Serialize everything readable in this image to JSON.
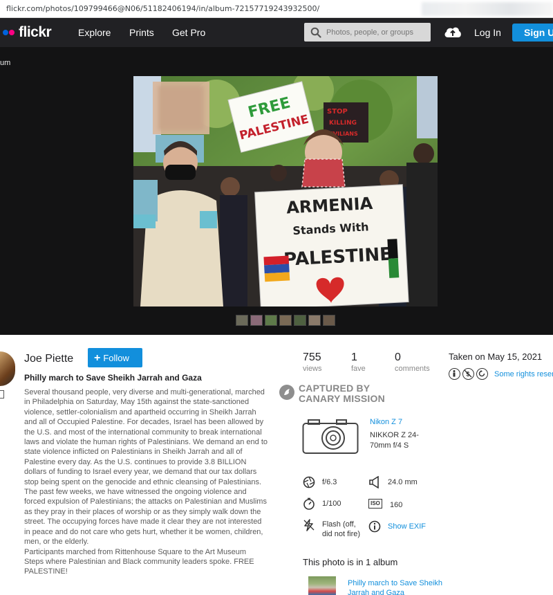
{
  "browser": {
    "url": "flickr.com/photos/109799466@N06/51182406194/in/album-72157719243932500/"
  },
  "nav": {
    "logo_text": "flickr",
    "links": [
      "Explore",
      "Prints",
      "Get Pro"
    ],
    "search_placeholder": "Photos, people, or groups",
    "login": "Log In",
    "signup": "Sign Up",
    "icons": {
      "search": "search-icon",
      "upload": "cloud-upload-icon"
    }
  },
  "stage": {
    "crumb": "um",
    "photo_signs": {
      "top_sign": [
        "FREE",
        "PALESTINE"
      ],
      "back_sign": [
        "STOP",
        "KILLING",
        "CIVILIANS"
      ],
      "main_sign": [
        "ARMENIA",
        "Stands With",
        "PALESTINE"
      ]
    },
    "filmstrip_count": 7
  },
  "author": {
    "name": "Joe Piette",
    "follow_label": "Follow"
  },
  "photo": {
    "title": "Philly march to Save Sheikh Jarrah and Gaza",
    "description": [
      "Several thousand people, very diverse and multi-generational, marched in Philadelphia on Saturday, May 15th against the state-sanctioned violence, settler-colonialism and apartheid occurring in Sheikh Jarrah and all of Occupied Palestine. For decades, Israel has been allowed by the U.S. and most of the international community to break international laws and violate the human rights of Palestinians. We demand an end to state violence inflicted on Palestinians in Sheikh Jarrah and all of Palestine every day. As the U.S. continues to provide 3.8 BILLION dollars of funding to Israel every year, we demand that our tax dollars stop being spent on the genocide and ethnic cleansing of Palestinians.",
      "The past few weeks, we have witnessed the ongoing violence and forced expulsion of Palestinians; the attacks on Palestinian and Muslims as they pray in their places of worship or as they simply walk down the street. The occupying forces have made it clear they are not interested in peace and do not care who gets hurt, whether it be women, children, men, or the elderly.",
      "Participants marched from Rittenhouse Square to the Art Museum Steps where Palestinian and Black community leaders spoke. FREE PALESTINE!"
    ]
  },
  "stats": [
    {
      "value": "755",
      "label": "views"
    },
    {
      "value": "1",
      "label": "fave"
    },
    {
      "value": "0",
      "label": "comments"
    }
  ],
  "taken": "Taken on May 15, 2021",
  "rights": {
    "text": "Some rights reserved",
    "icons": [
      "cc-by-icon",
      "cc-nc-icon",
      "cc-sa-icon"
    ]
  },
  "watermark": [
    "CAPTURED BY",
    "CANARY MISSION"
  ],
  "camera": {
    "model": "Nikon Z 7",
    "lens": "NIKKOR Z 24-70mm f/4 S"
  },
  "exif": {
    "aperture": "f/6.3",
    "focal_length": "24.0 mm",
    "shutter": "1/100",
    "iso": "160",
    "flash": "Flash (off, did not fire)",
    "show_exif": "Show EXIF"
  },
  "album": {
    "heading": "This photo is in 1 album",
    "title": "Philly march to Save Sheikh Jarrah and Gaza"
  }
}
